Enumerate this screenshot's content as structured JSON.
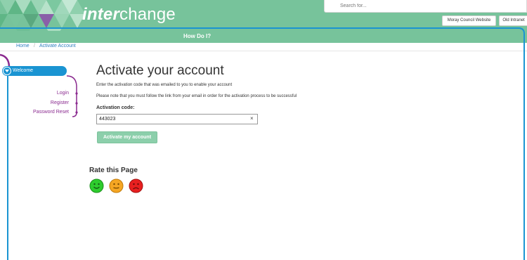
{
  "header": {
    "logo_bold": "inter",
    "logo_rest": "change",
    "search_placeholder": "Search for...",
    "external_links": [
      "Moray Council Website",
      "Old Intranet"
    ]
  },
  "nav": {
    "how_do_i": "How Do I?"
  },
  "breadcrumb": {
    "home": "Home",
    "separator": "/",
    "current": "Activate Account"
  },
  "sidebar": {
    "welcome": "Welcome",
    "links": [
      "Login",
      "Register",
      "Password Reset"
    ]
  },
  "main": {
    "title": "Activate your account",
    "intro": "Enter the activation code that was emailed to you to enable your account",
    "note": "Please note that you must follow the link from your email in order for the activation process to be successful",
    "code_label": "Activation code:",
    "code_value": "443023",
    "clear_symbol": "×",
    "activate_label": "Activate my account"
  },
  "rating": {
    "title": "Rate this Page",
    "options": [
      "happy",
      "neutral",
      "sad"
    ]
  },
  "colors": {
    "brand_green": "#77c39b",
    "accent_blue": "#1a94d2",
    "link_purple": "#8a2a8f",
    "happy": "#2ecc2e",
    "neutral": "#f5a623",
    "sad": "#e82020"
  }
}
